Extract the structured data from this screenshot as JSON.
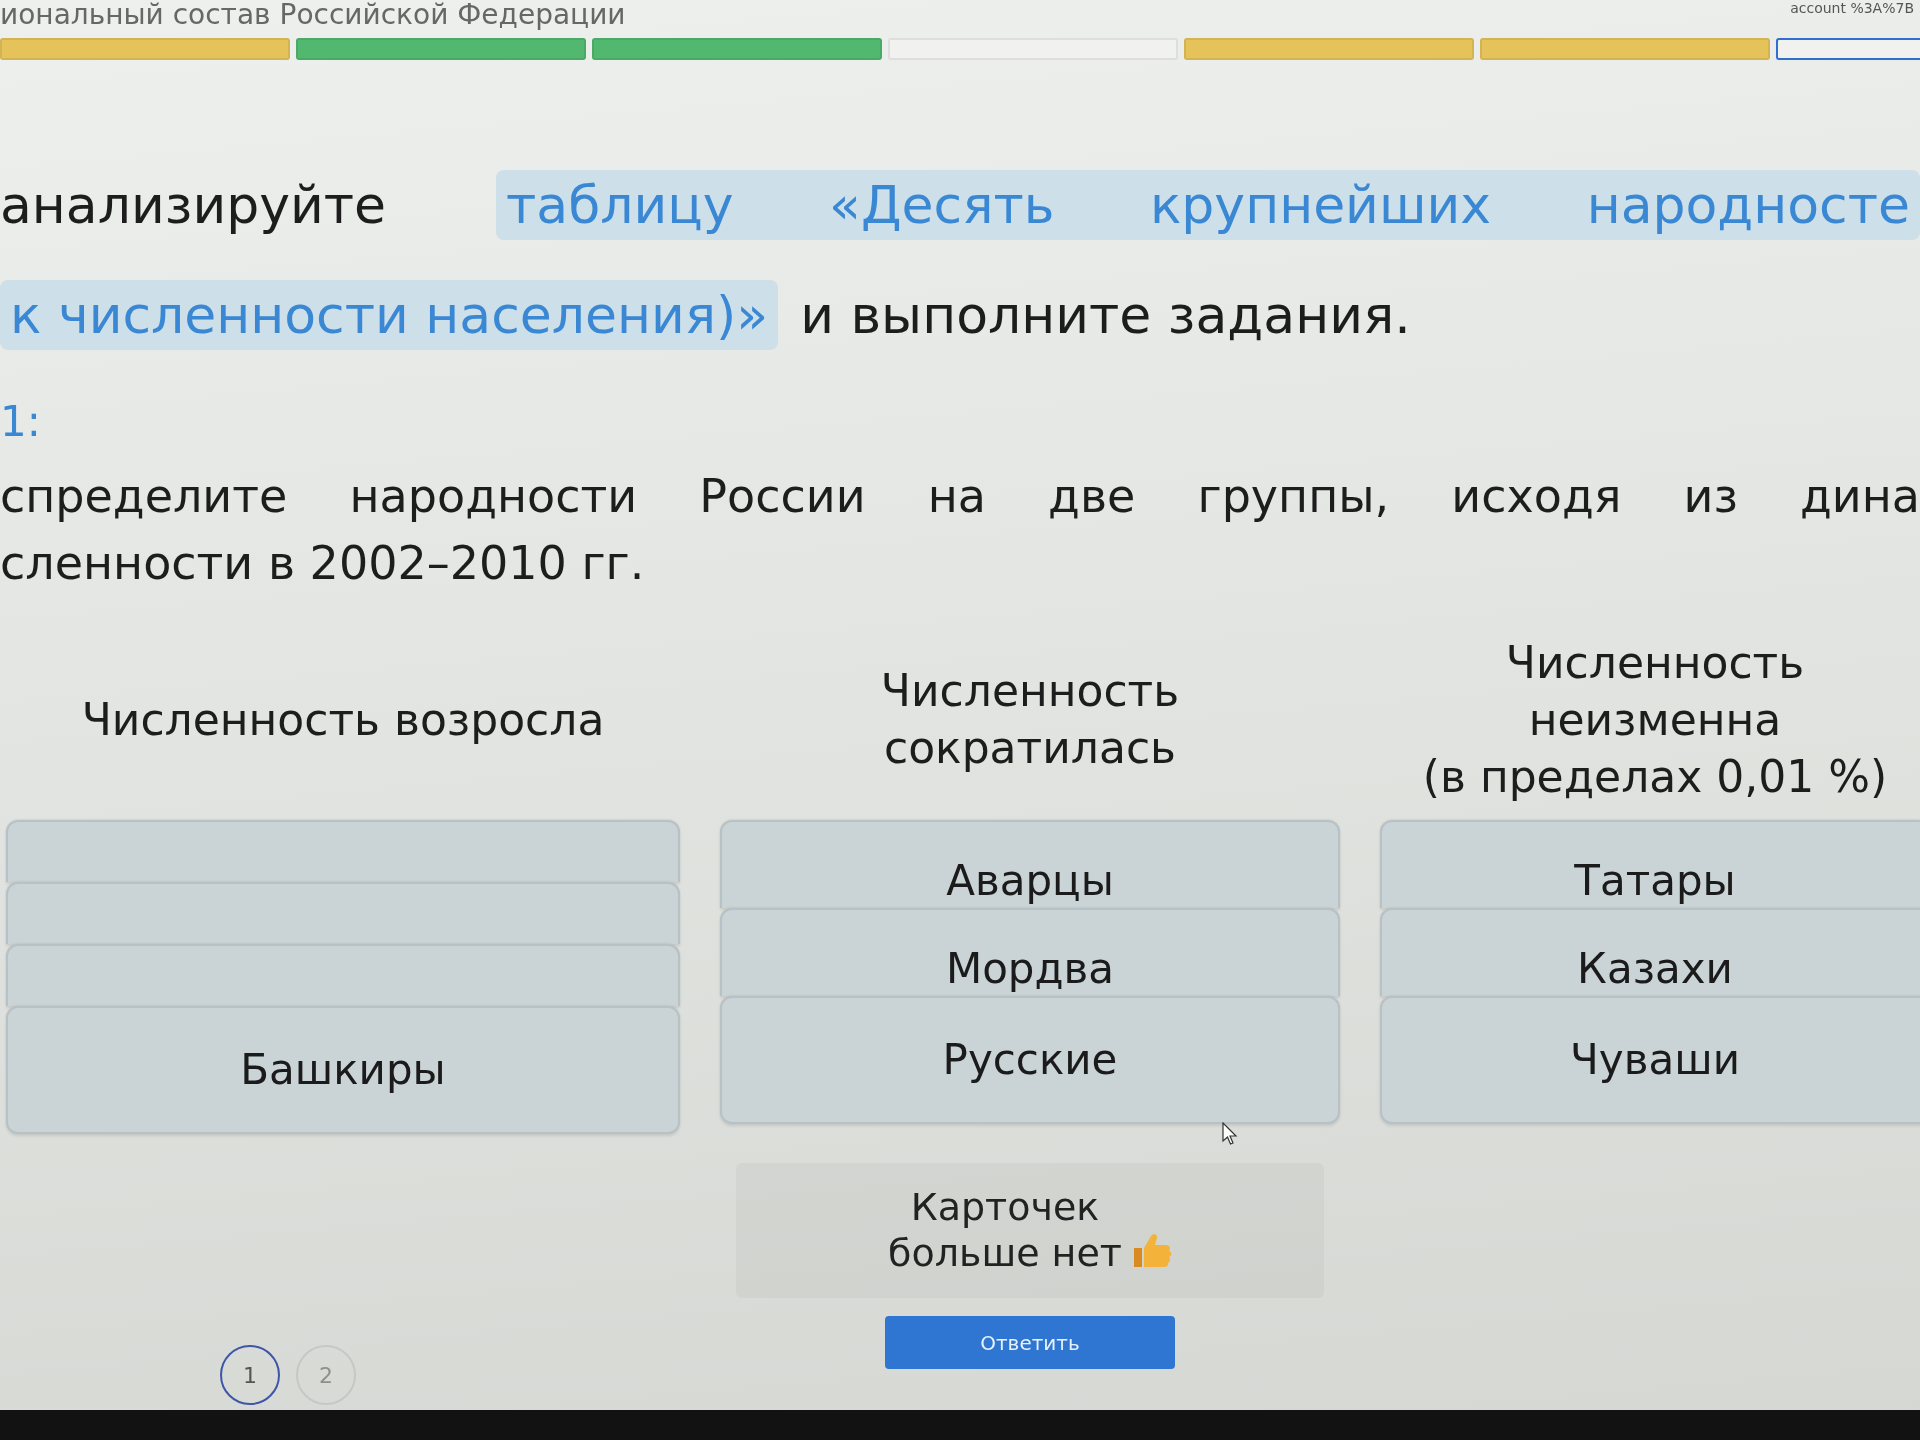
{
  "page": {
    "title": "иональный состав Российской Федерации",
    "corner_text": "account %3A%7B"
  },
  "progress": [
    {
      "color": "#e6c35a",
      "selected": false
    },
    {
      "color": "#52b86f",
      "selected": false
    },
    {
      "color": "#52b86f",
      "selected": false
    },
    {
      "color": "#f1f2f0",
      "selected": false
    },
    {
      "color": "#e6c35a",
      "selected": false
    },
    {
      "color": "#e6c35a",
      "selected": false
    },
    {
      "color": "#f1f2f0",
      "selected": true
    }
  ],
  "intro": [
    {
      "parts": [
        {
          "kind": "plain",
          "text": "анализируйте"
        },
        {
          "kind": "link",
          "text": "таблицу «Десять крупнейших народносте"
        }
      ]
    },
    {
      "parts": [
        {
          "kind": "link",
          "text": "к численности населения)»"
        },
        {
          "kind": "plain",
          "text": "и выполните задания."
        }
      ]
    }
  ],
  "task": {
    "label": "1:",
    "lines": [
      "спределите народности России на две группы, исходя из дина",
      "сленности в 2002–2010 гг."
    ]
  },
  "columns": [
    {
      "heading_lines": [
        "Численность возросла"
      ],
      "cards": [
        {
          "covered": true
        },
        {
          "covered": true
        },
        {
          "covered": true
        },
        {
          "covered": false,
          "label": "Башкиры"
        }
      ]
    },
    {
      "heading_lines": [
        "Численность",
        "сократилась"
      ],
      "cards": [
        {
          "covered": false,
          "label": "Аварцы"
        },
        {
          "covered": false,
          "label": "Мордва"
        },
        {
          "covered": false,
          "label": "Русские"
        }
      ]
    },
    {
      "heading_lines": [
        "Численность",
        "неизменна",
        "(в пределах 0,01 %)"
      ],
      "cards": [
        {
          "covered": false,
          "label": "Татары"
        },
        {
          "covered": false,
          "label": "Казахи"
        },
        {
          "covered": false,
          "label": "Чуваши"
        }
      ]
    }
  ],
  "empty_notice": {
    "lines": [
      "Карточек",
      "больше нет"
    ]
  },
  "submit_button": "Ответить",
  "pages": [
    {
      "label": "1",
      "selected": true
    },
    {
      "label": "2",
      "selected": false
    }
  ]
}
